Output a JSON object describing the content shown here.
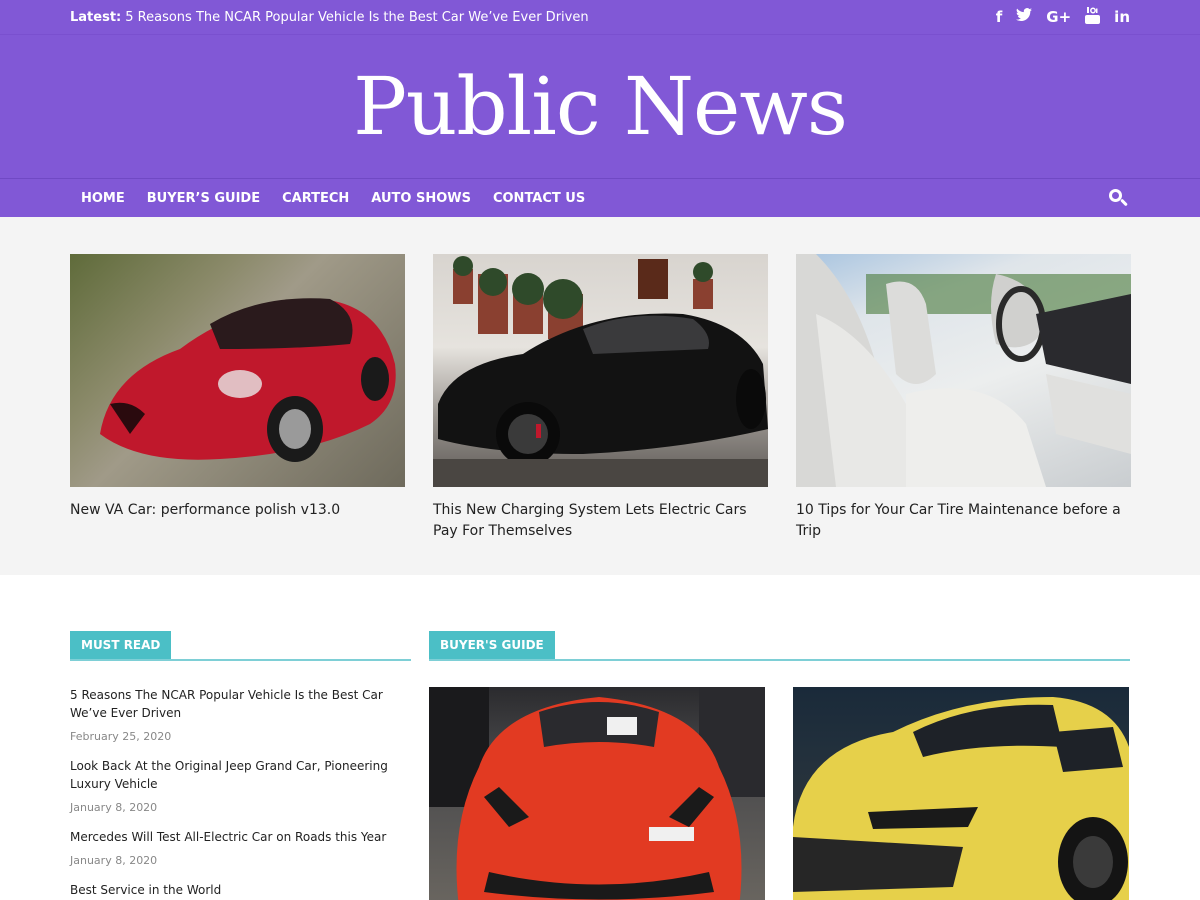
{
  "topbar": {
    "latest_label": "Latest:",
    "latest_text": "5 Reasons The NCAR Popular Vehicle Is the Best Car We’ve Ever Driven",
    "social": [
      "facebook-icon",
      "twitter-icon",
      "google-plus-icon",
      "youtube-icon",
      "linkedin-icon"
    ]
  },
  "site": {
    "title": "Public News"
  },
  "nav": {
    "items": [
      "HOME",
      "BUYER’S GUIDE",
      "CARTECH",
      "AUTO SHOWS",
      "CONTACT US"
    ]
  },
  "featured": [
    {
      "title": "New VA Car: performance polish v13.0"
    },
    {
      "title": "This New Charging System Lets Electric Cars Pay For Themselves"
    },
    {
      "title": "10 Tips for Your Car Tire Maintenance before a Trip"
    }
  ],
  "must_read": {
    "label": "MUST READ",
    "items": [
      {
        "title": "5 Reasons The NCAR Popular Vehicle Is the Best Car We’ve Ever Driven",
        "date": "February 25, 2020"
      },
      {
        "title": "Look Back At the Original Jeep Grand Car, Pioneering Luxury Vehicle",
        "date": "January 8, 2020"
      },
      {
        "title": "Mercedes Will Test All-Electric Car on Roads this Year",
        "date": "January 8, 2020"
      },
      {
        "title": "Best Service in the World",
        "date": ""
      }
    ]
  },
  "buyers_guide": {
    "label": "BUYER'S GUIDE"
  },
  "colors": {
    "brand": "#8158d6",
    "accent": "#4bbfc6"
  }
}
